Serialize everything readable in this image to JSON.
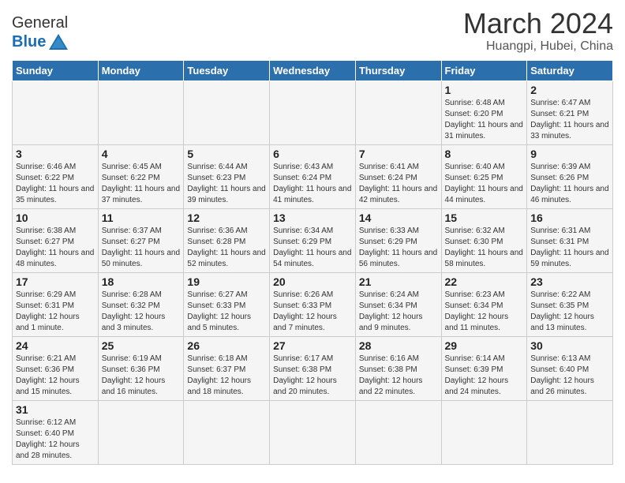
{
  "header": {
    "logo_text_general": "General",
    "logo_text_blue": "Blue",
    "month": "March 2024",
    "location": "Huangpi, Hubei, China"
  },
  "weekdays": [
    "Sunday",
    "Monday",
    "Tuesday",
    "Wednesday",
    "Thursday",
    "Friday",
    "Saturday"
  ],
  "weeks": [
    [
      {
        "day": "",
        "info": ""
      },
      {
        "day": "",
        "info": ""
      },
      {
        "day": "",
        "info": ""
      },
      {
        "day": "",
        "info": ""
      },
      {
        "day": "",
        "info": ""
      },
      {
        "day": "1",
        "info": "Sunrise: 6:48 AM\nSunset: 6:20 PM\nDaylight: 11 hours\nand 31 minutes."
      },
      {
        "day": "2",
        "info": "Sunrise: 6:47 AM\nSunset: 6:21 PM\nDaylight: 11 hours\nand 33 minutes."
      }
    ],
    [
      {
        "day": "3",
        "info": "Sunrise: 6:46 AM\nSunset: 6:22 PM\nDaylight: 11 hours\nand 35 minutes."
      },
      {
        "day": "4",
        "info": "Sunrise: 6:45 AM\nSunset: 6:22 PM\nDaylight: 11 hours\nand 37 minutes."
      },
      {
        "day": "5",
        "info": "Sunrise: 6:44 AM\nSunset: 6:23 PM\nDaylight: 11 hours\nand 39 minutes."
      },
      {
        "day": "6",
        "info": "Sunrise: 6:43 AM\nSunset: 6:24 PM\nDaylight: 11 hours\nand 41 minutes."
      },
      {
        "day": "7",
        "info": "Sunrise: 6:41 AM\nSunset: 6:24 PM\nDaylight: 11 hours\nand 42 minutes."
      },
      {
        "day": "8",
        "info": "Sunrise: 6:40 AM\nSunset: 6:25 PM\nDaylight: 11 hours\nand 44 minutes."
      },
      {
        "day": "9",
        "info": "Sunrise: 6:39 AM\nSunset: 6:26 PM\nDaylight: 11 hours\nand 46 minutes."
      }
    ],
    [
      {
        "day": "10",
        "info": "Sunrise: 6:38 AM\nSunset: 6:27 PM\nDaylight: 11 hours\nand 48 minutes."
      },
      {
        "day": "11",
        "info": "Sunrise: 6:37 AM\nSunset: 6:27 PM\nDaylight: 11 hours\nand 50 minutes."
      },
      {
        "day": "12",
        "info": "Sunrise: 6:36 AM\nSunset: 6:28 PM\nDaylight: 11 hours\nand 52 minutes."
      },
      {
        "day": "13",
        "info": "Sunrise: 6:34 AM\nSunset: 6:29 PM\nDaylight: 11 hours\nand 54 minutes."
      },
      {
        "day": "14",
        "info": "Sunrise: 6:33 AM\nSunset: 6:29 PM\nDaylight: 11 hours\nand 56 minutes."
      },
      {
        "day": "15",
        "info": "Sunrise: 6:32 AM\nSunset: 6:30 PM\nDaylight: 11 hours\nand 58 minutes."
      },
      {
        "day": "16",
        "info": "Sunrise: 6:31 AM\nSunset: 6:31 PM\nDaylight: 11 hours\nand 59 minutes."
      }
    ],
    [
      {
        "day": "17",
        "info": "Sunrise: 6:29 AM\nSunset: 6:31 PM\nDaylight: 12 hours\nand 1 minute."
      },
      {
        "day": "18",
        "info": "Sunrise: 6:28 AM\nSunset: 6:32 PM\nDaylight: 12 hours\nand 3 minutes."
      },
      {
        "day": "19",
        "info": "Sunrise: 6:27 AM\nSunset: 6:33 PM\nDaylight: 12 hours\nand 5 minutes."
      },
      {
        "day": "20",
        "info": "Sunrise: 6:26 AM\nSunset: 6:33 PM\nDaylight: 12 hours\nand 7 minutes."
      },
      {
        "day": "21",
        "info": "Sunrise: 6:24 AM\nSunset: 6:34 PM\nDaylight: 12 hours\nand 9 minutes."
      },
      {
        "day": "22",
        "info": "Sunrise: 6:23 AM\nSunset: 6:34 PM\nDaylight: 12 hours\nand 11 minutes."
      },
      {
        "day": "23",
        "info": "Sunrise: 6:22 AM\nSunset: 6:35 PM\nDaylight: 12 hours\nand 13 minutes."
      }
    ],
    [
      {
        "day": "24",
        "info": "Sunrise: 6:21 AM\nSunset: 6:36 PM\nDaylight: 12 hours\nand 15 minutes."
      },
      {
        "day": "25",
        "info": "Sunrise: 6:19 AM\nSunset: 6:36 PM\nDaylight: 12 hours\nand 16 minutes."
      },
      {
        "day": "26",
        "info": "Sunrise: 6:18 AM\nSunset: 6:37 PM\nDaylight: 12 hours\nand 18 minutes."
      },
      {
        "day": "27",
        "info": "Sunrise: 6:17 AM\nSunset: 6:38 PM\nDaylight: 12 hours\nand 20 minutes."
      },
      {
        "day": "28",
        "info": "Sunrise: 6:16 AM\nSunset: 6:38 PM\nDaylight: 12 hours\nand 22 minutes."
      },
      {
        "day": "29",
        "info": "Sunrise: 6:14 AM\nSunset: 6:39 PM\nDaylight: 12 hours\nand 24 minutes."
      },
      {
        "day": "30",
        "info": "Sunrise: 6:13 AM\nSunset: 6:40 PM\nDaylight: 12 hours\nand 26 minutes."
      }
    ],
    [
      {
        "day": "31",
        "info": "Sunrise: 6:12 AM\nSunset: 6:40 PM\nDaylight: 12 hours\nand 28 minutes."
      },
      {
        "day": "",
        "info": ""
      },
      {
        "day": "",
        "info": ""
      },
      {
        "day": "",
        "info": ""
      },
      {
        "day": "",
        "info": ""
      },
      {
        "day": "",
        "info": ""
      },
      {
        "day": "",
        "info": ""
      }
    ]
  ]
}
